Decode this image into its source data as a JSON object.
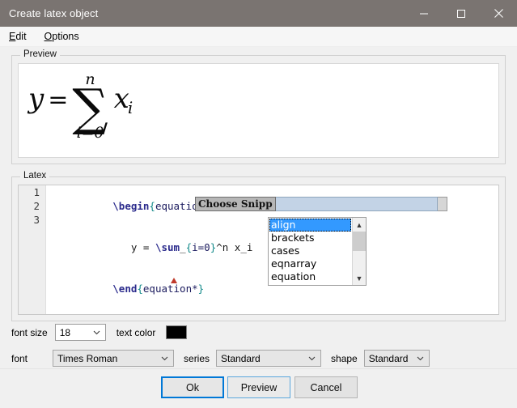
{
  "window": {
    "title": "Create latex object",
    "controls": {
      "minimize": "minimize-icon",
      "maximize": "maximize-icon",
      "close": "close-icon"
    },
    "titlebar_color": "#7a7471"
  },
  "menubar": {
    "items": [
      {
        "label": "Edit",
        "mnemonic": "E"
      },
      {
        "label": "Options",
        "mnemonic": "O"
      }
    ]
  },
  "preview": {
    "group_label": "Preview",
    "formula": {
      "lhs": "y",
      "equals": "=",
      "sum_glyph": "∑",
      "sum_upper": "n",
      "sum_lower": "i=0",
      "term": "x",
      "term_subscript": "i"
    }
  },
  "latex": {
    "group_label": "Latex",
    "line_numbers": [
      "1",
      "2",
      "3"
    ],
    "lines": [
      {
        "number": "1",
        "tokens": [
          {
            "text": "\\begin",
            "type": "cmd"
          },
          {
            "text": "{",
            "type": "brace"
          },
          {
            "text": "equation*",
            "type": "arg"
          },
          {
            "text": "}",
            "type": "brace"
          }
        ]
      },
      {
        "number": "2",
        "tokens": [
          {
            "text": "   y = ",
            "type": "plain"
          },
          {
            "text": "\\sum",
            "type": "cmd"
          },
          {
            "text": "_",
            "type": "plain"
          },
          {
            "text": "{",
            "type": "brace"
          },
          {
            "text": "i=0",
            "type": "arg"
          },
          {
            "text": "}",
            "type": "brace"
          },
          {
            "text": "^n x_i",
            "type": "plain"
          }
        ]
      },
      {
        "number": "3",
        "tokens": [
          {
            "text": "\\end",
            "type": "cmd"
          },
          {
            "text": "{",
            "type": "brace"
          },
          {
            "text": "equation*",
            "type": "arg"
          },
          {
            "text": "}",
            "type": "brace"
          }
        ]
      }
    ],
    "error_marker": "error-triangle-icon"
  },
  "snippet_popup": {
    "label": "Choose Snipp",
    "input_value": "",
    "options": [
      {
        "label": "align",
        "selected": true
      },
      {
        "label": "brackets",
        "selected": false
      },
      {
        "label": "cases",
        "selected": false
      },
      {
        "label": "eqnarray",
        "selected": false
      },
      {
        "label": "equation",
        "selected": false
      }
    ],
    "scroll_up": "▲",
    "scroll_down": "▼",
    "highlight_color": "#3399ff"
  },
  "controls": {
    "font_size_label": "font size",
    "font_size_value": "18",
    "text_color_label": "text color",
    "text_color_value": "#000000",
    "font_label": "font",
    "font_value": "Times Roman",
    "series_label": "series",
    "series_value": "Standard",
    "shape_label": "shape",
    "shape_value": "Standard",
    "caret_glyph": "⌄"
  },
  "buttons": {
    "ok": "Ok",
    "preview": "Preview",
    "cancel": "Cancel"
  }
}
